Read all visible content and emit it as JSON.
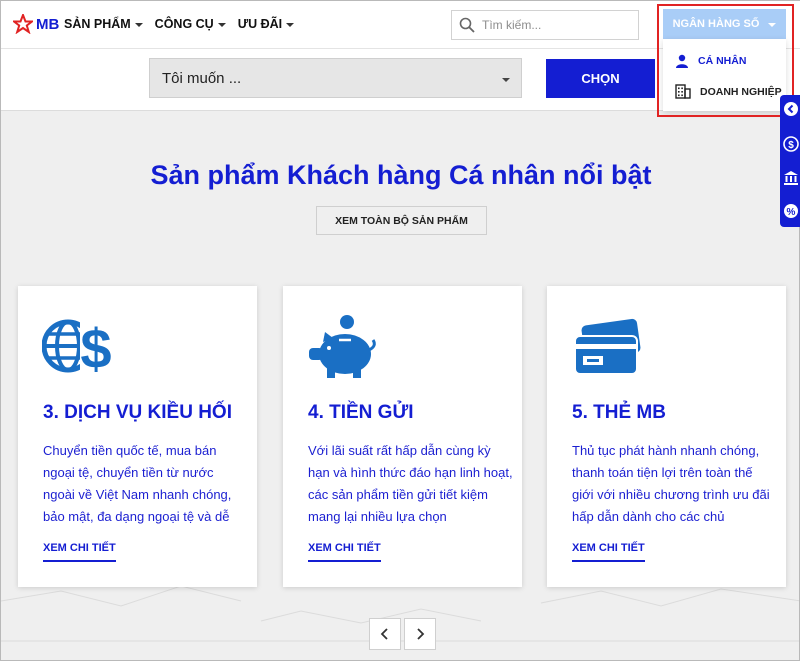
{
  "brand": {
    "name": "MB",
    "accent": "#141ed2",
    "highlight": "#e12323"
  },
  "nav": {
    "items": [
      {
        "label": "SẢN PHẨM"
      },
      {
        "label": "CÔNG CỤ"
      },
      {
        "label": "ƯU ĐÃI"
      }
    ],
    "search": {
      "placeholder": "Tìm kiếm...",
      "icon": "search-icon"
    },
    "ebanking": {
      "label": "NGÂN HÀNG SỐ"
    }
  },
  "dropdown": {
    "items": [
      {
        "label": "CÁ NHÂN",
        "icon": "person-icon"
      },
      {
        "label": "DOANH NGHIỆP",
        "icon": "building-icon"
      }
    ]
  },
  "subbar": {
    "select_value": "Tôi muốn ...",
    "choose_label": "CHỌN"
  },
  "sidetabs": [
    "back-icon",
    "dollar-icon",
    "bank-icon",
    "percent-icon"
  ],
  "main": {
    "headline": "Sản phẩm Khách hàng Cá nhân nổi bật",
    "view_all": "XEM TOÀN BỘ SẢN PHẨM",
    "cards": [
      {
        "title": "3. DỊCH VỤ KIỀU HỐI",
        "icon": "globe-dollar-icon",
        "desc": "Chuyển tiền quốc tế, mua bán ngoại tệ, chuyển tiền từ nước ngoài về Việt Nam nhanh chóng, bảo mật, đa dạng ngoại tệ và dễ",
        "link": "XEM CHI TIẾT"
      },
      {
        "title": "4. TIỀN GỬI",
        "icon": "piggy-bank-icon",
        "desc": "Với lãi suất rất hấp dẫn cùng kỳ hạn và hình thức đáo hạn linh hoạt, các sản phẩm tiền gửi tiết kiệm mang lại nhiều lựa chọn",
        "link": "XEM CHI TIẾT"
      },
      {
        "title": "5. THẺ MB",
        "icon": "credit-card-icon",
        "desc": "Thủ tục phát hành nhanh chóng, thanh toán tiện lợi trên toàn thế giới với nhiều chương trình ưu đãi hấp dẫn dành cho các chủ",
        "link": "XEM CHI TIẾT"
      }
    ]
  }
}
